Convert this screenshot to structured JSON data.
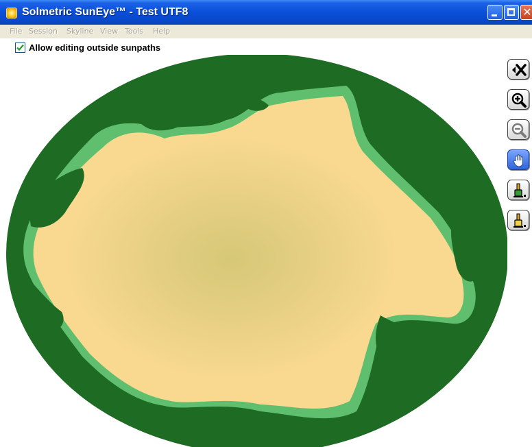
{
  "window": {
    "title": "Solmetric SunEye™ - Test UTF8",
    "app_icon": "sun-icon",
    "controls": [
      "minimize-icon",
      "maximize-icon",
      "close-icon"
    ]
  },
  "menu": {
    "items": [
      "File",
      "Session",
      "Skyline",
      "View",
      "Tools",
      "Help"
    ]
  },
  "options": {
    "allow_editing_label": "Allow editing outside sunpaths",
    "allow_editing_checked": true
  },
  "toolbar": {
    "tools": [
      {
        "icon": "close-edit-icon",
        "active": false
      },
      {
        "icon": "zoom-in-icon",
        "active": false
      },
      {
        "icon": "zoom-out-icon",
        "active": false
      },
      {
        "icon": "pan-hand-icon",
        "active": true
      },
      {
        "icon": "paint-shade-brush-icon",
        "active": false
      },
      {
        "icon": "paint-sky-brush-icon",
        "active": false
      }
    ]
  },
  "colors": {
    "sky": "#f8d98f",
    "sky_center": "#d7c97a",
    "obstruction": "#1e6b24",
    "obstruction_edge": "#6fcf7e",
    "title_bar": "#0a4fd8",
    "menu_bar": "#ece9d8"
  }
}
